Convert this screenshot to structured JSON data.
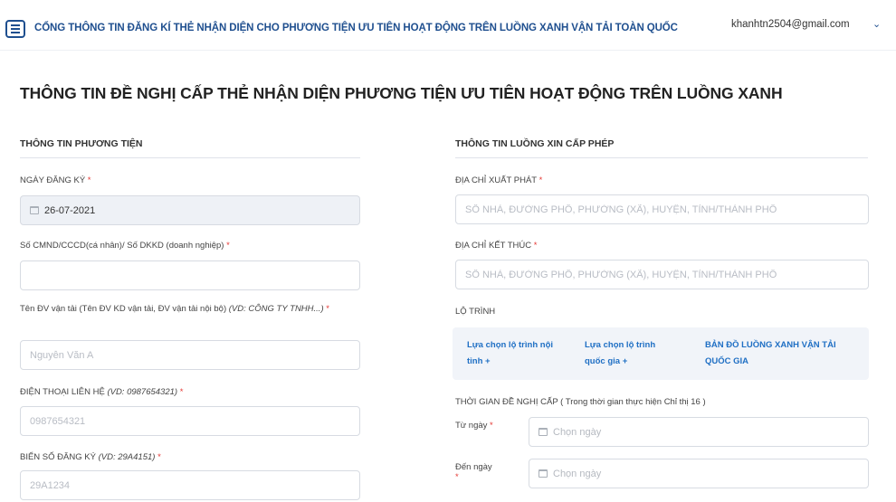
{
  "header": {
    "menu_icon": "hamburger-menu-icon",
    "portal_title": "CỔNG THÔNG TIN ĐĂNG KÍ THẺ NHẬN DIỆN CHO PHƯƠNG TIỆN ƯU TIÊN HOẠT ĐỘNG TRÊN LUỒNG XANH VẬN TẢI TOÀN QUỐC",
    "user_email": "khanhtn2504@gmail.com",
    "user_chevron": "⌄"
  },
  "page": {
    "title": "THÔNG TIN ĐỀ NGHỊ CẤP THẺ NHẬN DIỆN PHƯƠNG TIỆN ƯU TIÊN HOẠT ĐỘNG TRÊN LUỒNG XANH"
  },
  "vehicle": {
    "section_title": "THÔNG TIN PHƯƠNG TIỆN",
    "reg_date_label": "NGÀY ĐĂNG KÝ",
    "reg_date_value": "26-07-2021",
    "id_label": "Số CMND/CCCD(cá nhân)/ Số DKKD (doanh nghiệp)",
    "id_value": "",
    "company_label": "Tên ĐV vận tải (Tên ĐV KD vận tải, ĐV vận tải nội bộ)",
    "company_hint": "(VD: CÔNG TY TNHH...)",
    "company_placeholder": "Nguyễn Văn A",
    "phone_label": "ĐIỆN THOẠI LIÊN HỆ",
    "phone_hint": "(VD: 0987654321)",
    "phone_placeholder": "0987654321",
    "plate_label": "BIỂN SỐ ĐĂNG KÝ",
    "plate_hint": "(VD: 29A4151)",
    "plate_placeholder": "29A1234",
    "required_mark": "*"
  },
  "route": {
    "section_title": "THÔNG TIN LUỒNG XIN CẤP PHÉP",
    "start_label": "ĐỊA CHỈ XUẤT PHÁT",
    "start_placeholder": "SỐ NHÀ, ĐƯỜNG PHỐ, PHƯỜNG (XÃ), HUYỆN, TỈNH/THÀNH PHỐ",
    "end_label": "ĐỊA CHỈ KẾT THÚC",
    "end_placeholder": "SỐ NHÀ, ĐƯỜNG PHỐ, PHƯỜNG (XÃ), HUYỆN, TỈNH/THÀNH PHỐ",
    "itinerary_label": "LỘ TRÌNH",
    "links": {
      "provincial_line1": "Lựa chọn lộ trình nội",
      "provincial_line2": "tỉnh +",
      "national_line1": "Lựa chọn lộ trình",
      "national_line2": "quốc gia +",
      "map_line1": "BẢN ĐỒ LUỒNG XANH VẬN TẢI",
      "map_line2": "QUỐC GIA"
    },
    "period_label": "THỜI GIAN ĐỀ NGHỊ CẤP ( Trong thời gian thực hiện Chỉ thị 16 )",
    "from_label": "Từ ngày",
    "to_label": "Đến ngày",
    "date_placeholder": "Chọn ngày",
    "required_mark": "*"
  }
}
